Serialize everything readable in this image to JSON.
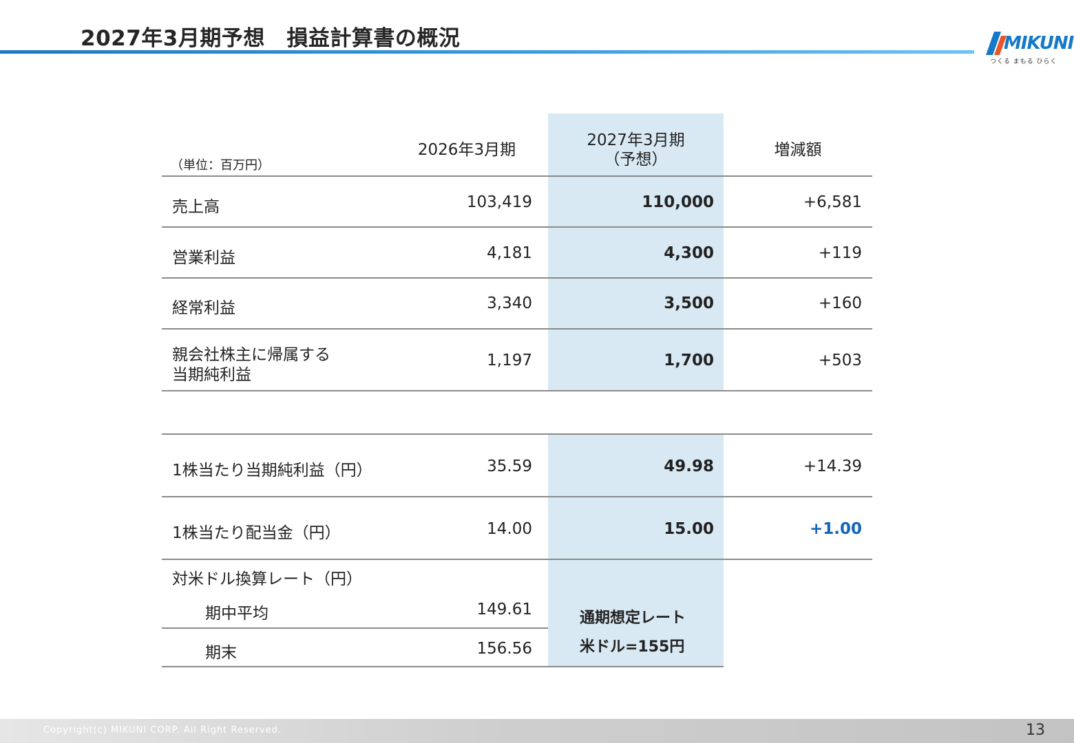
{
  "title": "2027年3月期予想　損益計算書の概況",
  "logo": {
    "text": "MIKUNI",
    "tagline": "つくる まもる ひらく",
    "color": "#1479c9"
  },
  "table": {
    "unit": "（単位：百万円）",
    "headers": {
      "prev": "2026年3月期",
      "forecast_line1": "2027年3月期",
      "forecast_line2": "（予想）",
      "diff": "増減額"
    },
    "rows": [
      {
        "label": "売上高",
        "prev": "103,419",
        "forecast": "110,000",
        "diff": "+6,581"
      },
      {
        "label": "営業利益",
        "prev": "4,181",
        "forecast": "4,300",
        "diff": "+119"
      },
      {
        "label": "経常利益",
        "prev": "3,340",
        "forecast": "3,500",
        "diff": "+160"
      },
      {
        "label_line1": "親会社株主に帰属する",
        "label_line2": "当期純利益",
        "prev": "1,197",
        "forecast": "1,700",
        "diff": "+503"
      }
    ],
    "per_share_rows": [
      {
        "label": "1株当たり当期純利益（円）",
        "prev": "35.59",
        "forecast": "49.98",
        "diff": "+14.39"
      },
      {
        "label": "1株当たり配当金（円）",
        "prev": "14.00",
        "forecast": "15.00",
        "diff": "+1.00"
      }
    ],
    "fx": {
      "label": "対米ドル換算レート（円）",
      "avg_label": "期中平均",
      "avg_value": "149.61",
      "end_label": "期末",
      "end_value": "156.56",
      "note_line1": "通期想定レート",
      "note_line2": "米ドル=155円"
    },
    "highlight_color": "#d9e9f4",
    "accent_color": "#1565b8"
  },
  "footer": {
    "copyright": "Copyright(c) MIKUNI CORP. All Right Reserved.",
    "page_number": "13"
  }
}
